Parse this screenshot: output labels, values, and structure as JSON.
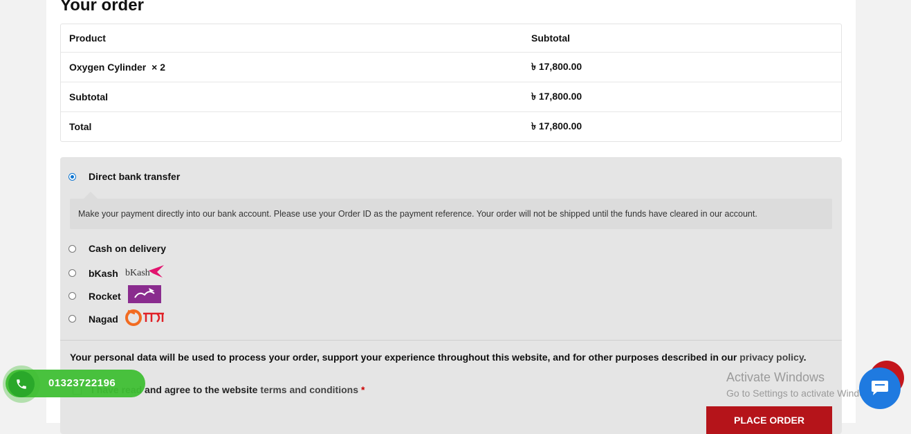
{
  "order": {
    "title": "Your order",
    "header": {
      "product": "Product",
      "subtotal": "Subtotal"
    },
    "items": [
      {
        "name": "Oxygen Cylinder",
        "qty": "× 2",
        "amount": "৳ 17,800.00"
      }
    ],
    "subtotal_label": "Subtotal",
    "subtotal_value": "৳ 17,800.00",
    "total_label": "Total",
    "total_value": "৳ 17,800.00"
  },
  "payment": {
    "methods": [
      {
        "label": "Direct bank transfer",
        "selected": true
      },
      {
        "label": "Cash on delivery",
        "selected": false
      },
      {
        "label": "bKash",
        "selected": false,
        "logo": "bKash"
      },
      {
        "label": "Rocket",
        "selected": false,
        "logo": "rocket-logo"
      },
      {
        "label": "Nagad",
        "selected": false,
        "logo": "nagad-logo"
      }
    ],
    "bank_description": "Make your payment directly into our bank account. Please use your Order ID as the payment reference. Your order will not be shipped until the funds have cleared in our account.",
    "privacy_text": "Your personal data will be used to process your order, support your experience throughout this website, and for other purposes described in our",
    "privacy_link": "privacy policy",
    "privacy_end": ".",
    "terms_text": "I have read and agree to the website",
    "terms_link": "terms and conditions",
    "terms_required": "*",
    "place_order": "PLACE ORDER"
  },
  "contact": {
    "phone": "01323722196"
  },
  "watermark": {
    "line1": "Activate Windows",
    "line2": "Go to Settings to activate Windows."
  },
  "colors": {
    "accent": "#b5141a",
    "radio": "#0b74d1",
    "whatsapp": "#3fbf34",
    "chat": "#1f7ae0"
  }
}
